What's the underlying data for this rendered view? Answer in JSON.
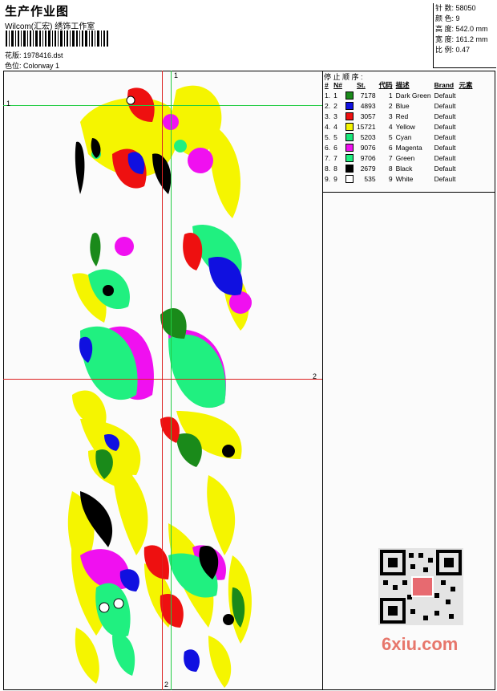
{
  "header": {
    "title": "生产作业图",
    "company": "Wilcom(汇宏) 绣饰工作室",
    "design_label": "花版: 1978416.dst",
    "colorway_label": "色位: Colorway 1"
  },
  "stats": {
    "stitches": "针 数: 58050",
    "colors": "颜 色: 9",
    "height": "高 度: 542.0 mm",
    "width": "宽 度: 161.2 mm",
    "scale": "比 例: 0.47"
  },
  "stop_sequence": {
    "title": "停 止 顺 序 :",
    "headers": [
      "#",
      "N#",
      "St.",
      "代码",
      "描述",
      "Brand",
      "元素"
    ],
    "rows": [
      {
        "idx": "1.",
        "n": "1",
        "st": "7178",
        "code": "1",
        "desc": "Dark Green",
        "brand": "Default",
        "color": "#1a8a1a"
      },
      {
        "idx": "2.",
        "n": "2",
        "st": "4893",
        "code": "2",
        "desc": "Blue",
        "brand": "Default",
        "color": "#1010e0"
      },
      {
        "idx": "3.",
        "n": "3",
        "st": "3057",
        "code": "3",
        "desc": "Red",
        "brand": "Default",
        "color": "#ee1010"
      },
      {
        "idx": "4.",
        "n": "4",
        "st": "15721",
        "code": "4",
        "desc": "Yellow",
        "brand": "Default",
        "color": "#f5f500"
      },
      {
        "idx": "5.",
        "n": "5",
        "st": "5203",
        "code": "5",
        "desc": "Cyan",
        "brand": "Default",
        "color": "#19e87a"
      },
      {
        "idx": "6.",
        "n": "6",
        "st": "9076",
        "code": "6",
        "desc": "Magenta",
        "brand": "Default",
        "color": "#f010f0"
      },
      {
        "idx": "7.",
        "n": "7",
        "st": "9706",
        "code": "7",
        "desc": "Green",
        "brand": "Default",
        "color": "#20f080"
      },
      {
        "idx": "8.",
        "n": "8",
        "st": "2679",
        "code": "8",
        "desc": "Black",
        "brand": "Default",
        "color": "#000000"
      },
      {
        "idx": "9.",
        "n": "9",
        "st": "535",
        "code": "9",
        "desc": "White",
        "brand": "Default",
        "color": "#ffffff"
      }
    ]
  },
  "guides": {
    "top_v": "1",
    "top_h": "1",
    "mid_h": "2",
    "bottom_v": "2",
    "h1_color": "#22cc44",
    "v1_color": "#22cc44",
    "h2_color": "#dd2222",
    "v2_color": "#dd2222"
  },
  "watermark": "6xiu.com"
}
